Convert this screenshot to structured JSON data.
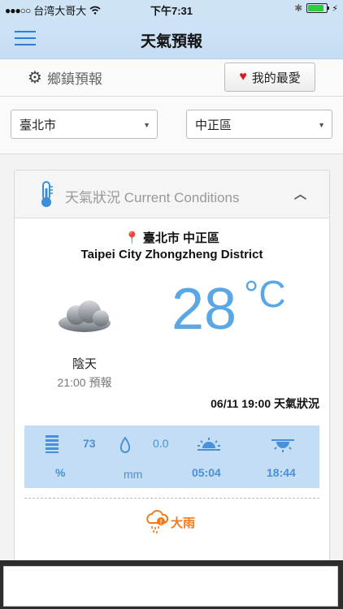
{
  "statusbar": {
    "signal": "●●●○○",
    "carrier": "台湾大哥大",
    "time": "下午7:31"
  },
  "navbar": {
    "title": "天氣預報"
  },
  "toolbar": {
    "town_label": "鄉鎮預報",
    "favorite_label": "我的最愛"
  },
  "selects": {
    "city": "臺北市",
    "district": "中正區"
  },
  "card": {
    "title": "天氣狀況 Current Conditions",
    "location_zh": "臺北市 中正區",
    "location_en": "Taipei City Zhongzheng District",
    "condition": "陰天",
    "forecast_time": "21:00 預報",
    "temperature": "28",
    "unit": "°C",
    "observed": "06/11 19:00 天氣狀況",
    "stats": {
      "humidity_value": "73",
      "humidity_unit": "%",
      "rain_value": "0.0",
      "rain_unit": "mm",
      "sunrise": "05:04",
      "sunset": "18:44"
    },
    "alert": "大雨"
  },
  "colors": {
    "accent_blue": "#5aa7e6",
    "alert_orange": "#f07a20",
    "heart_red": "#d71920"
  }
}
